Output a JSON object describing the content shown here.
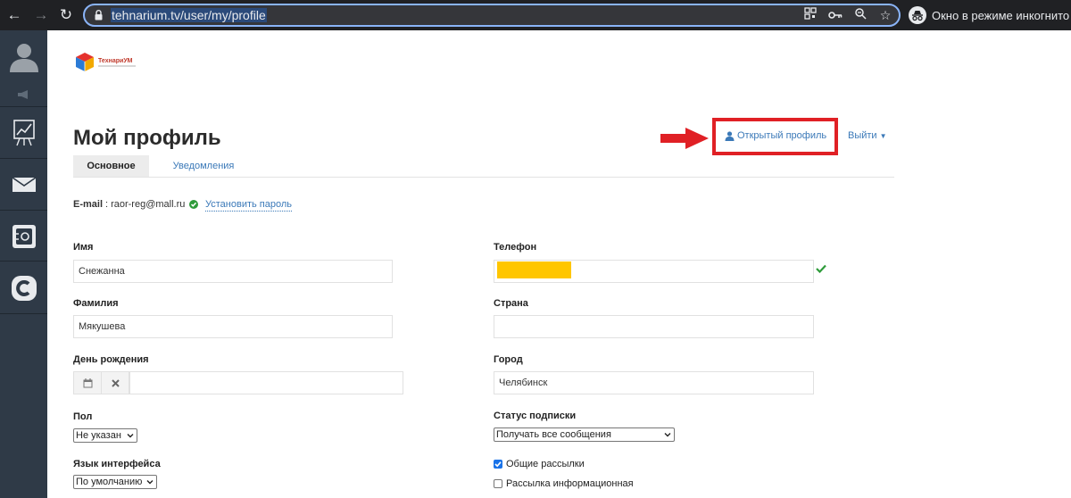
{
  "browser": {
    "url": "tehnarium.tv/user/my/profile",
    "incognito_label": "Окно в режиме инкогнито"
  },
  "sidebar": {
    "items": [
      {
        "icon": "user-avatar-icon"
      },
      {
        "icon": "megaphone-icon"
      },
      {
        "icon": "chart-board-icon"
      },
      {
        "icon": "mail-icon"
      },
      {
        "icon": "safe-icon"
      },
      {
        "icon": "c-logo-icon"
      }
    ]
  },
  "logo": {
    "text": "ТехнариУМ"
  },
  "page": {
    "title": "Мой профиль",
    "open_profile": "Открытый профиль",
    "logout": "Выйти",
    "tabs": [
      {
        "label": "Основное",
        "active": true
      },
      {
        "label": "Уведомления",
        "active": false
      }
    ]
  },
  "email": {
    "label": "E-mail",
    "value": "raor-reg@mall.ru",
    "set_password": "Установить пароль"
  },
  "form": {
    "name_label": "Имя",
    "name_value": "Снежанна",
    "surname_label": "Фамилия",
    "surname_value": "Мякушева",
    "birthday_label": "День рождения",
    "birthday_value": "",
    "gender_label": "Пол",
    "gender_value": "Не указан",
    "lang_label": "Язык интерфейса",
    "lang_value": "По умолчанию",
    "phone_label": "Телефон",
    "country_label": "Страна",
    "country_value": "",
    "city_label": "Город",
    "city_value": "Челябинск",
    "subscription_label": "Статус подписки",
    "subscription_value": "Получать все сообщения",
    "general_mailings": "Общие рассылки",
    "general_mailings_checked": true,
    "info_mailing": "Рассылка информационная",
    "info_mailing_checked": false
  },
  "colors": {
    "highlight_box": "#e02025",
    "link": "#3b79b8",
    "phone_redaction": "#ffc600",
    "verified": "#2e9b3a"
  }
}
